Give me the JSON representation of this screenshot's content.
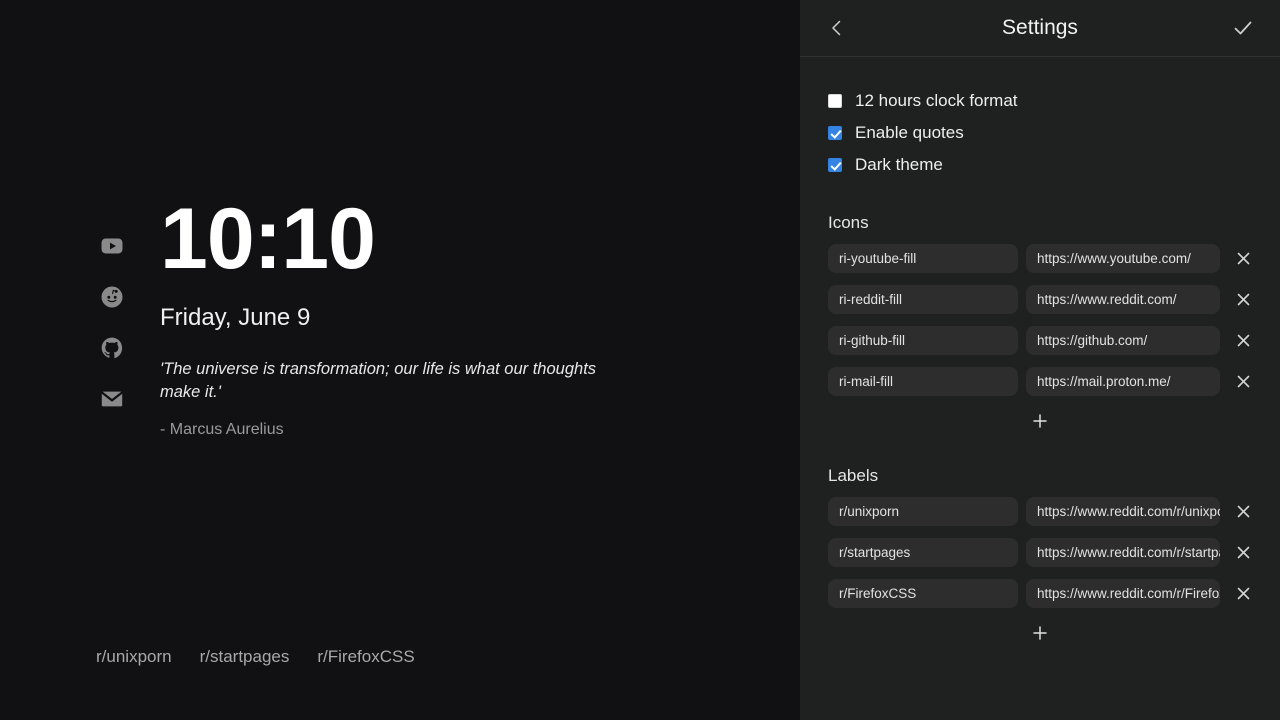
{
  "startpage": {
    "clock": "10:10",
    "date": "Friday, June 9",
    "quote": "'The universe is transformation; our life is what our thoughts make it.'",
    "quote_author": "- Marcus Aurelius",
    "rail_icons": [
      {
        "icon": "youtube-icon",
        "name": "ri-youtube-fill"
      },
      {
        "icon": "reddit-icon",
        "name": "ri-reddit-fill"
      },
      {
        "icon": "github-icon",
        "name": "ri-github-fill"
      },
      {
        "icon": "mail-icon",
        "name": "ri-mail-fill"
      }
    ],
    "bottom_labels": [
      {
        "label": "r/unixporn"
      },
      {
        "label": "r/startpages"
      },
      {
        "label": "r/FirefoxCSS"
      }
    ]
  },
  "settings": {
    "title": "Settings",
    "back_icon": "chevron-left-icon",
    "confirm_icon": "check-icon",
    "checkboxes": [
      {
        "label": "12 hours clock format",
        "checked": false
      },
      {
        "label": "Enable quotes",
        "checked": true
      },
      {
        "label": "Dark theme",
        "checked": true
      }
    ],
    "icons_section": {
      "title": "Icons",
      "add_label": "+",
      "rows": [
        {
          "name": "ri-youtube-fill",
          "url": "https://www.youtube.com/",
          "delete_label": "×"
        },
        {
          "name": "ri-reddit-fill",
          "url": "https://www.reddit.com/",
          "delete_label": "×"
        },
        {
          "name": "ri-github-fill",
          "url": "https://github.com/",
          "delete_label": "×"
        },
        {
          "name": "ri-mail-fill",
          "url": "https://mail.proton.me/",
          "delete_label": "×"
        }
      ]
    },
    "labels_section": {
      "title": "Labels",
      "add_label": "+",
      "rows": [
        {
          "name": "r/unixporn",
          "url": "https://www.reddit.com/r/unixporn/",
          "delete_label": "×"
        },
        {
          "name": "r/startpages",
          "url": "https://www.reddit.com/r/startpages/",
          "delete_label": "×"
        },
        {
          "name": "r/FirefoxCSS",
          "url": "https://www.reddit.com/r/FirefoxCSS/",
          "delete_label": "×"
        }
      ]
    }
  },
  "colors": {
    "background": "#111113",
    "panel": "#1f2020",
    "field": "#2d2d2d",
    "accent": "#3584e4",
    "text": "#eeeeee",
    "muted": "#9a9a9a"
  }
}
